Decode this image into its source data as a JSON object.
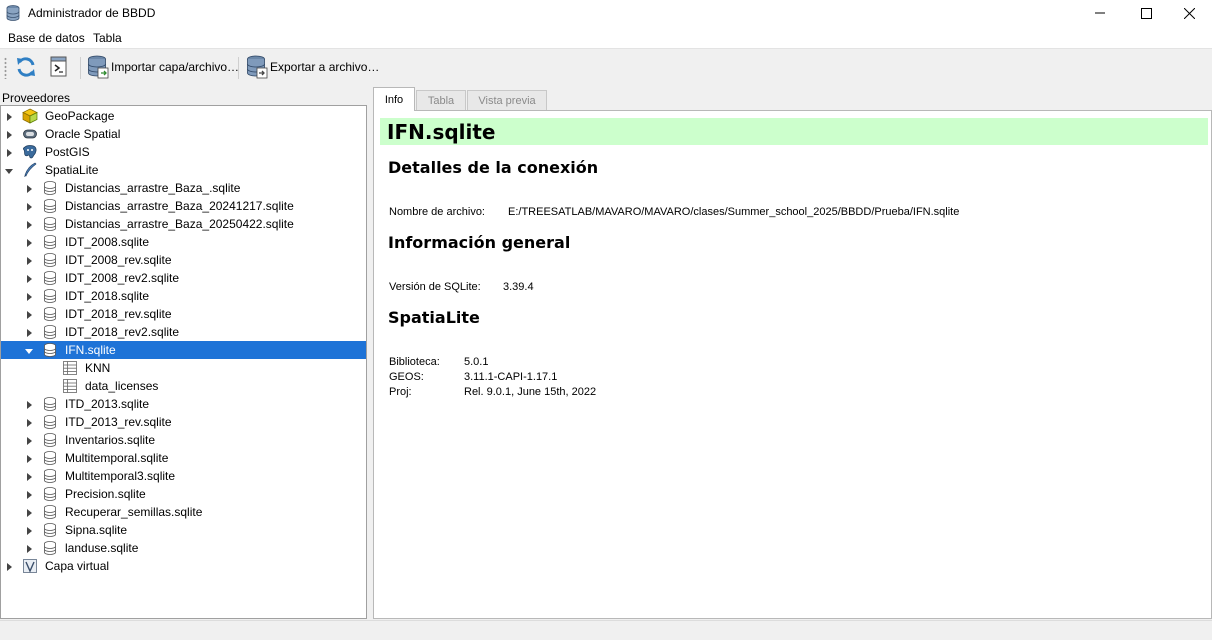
{
  "window": {
    "title": "Administrador de BBDD"
  },
  "menu": {
    "items": [
      "Base de datos",
      "Tabla"
    ]
  },
  "toolbar": {
    "import_label": "Importar capa/archivo…",
    "export_label": "Exportar a archivo…"
  },
  "providers": {
    "header": "Proveedores",
    "items": [
      {
        "label": "GeoPackage",
        "level": 0,
        "expanded": false,
        "icon": "geopackage-icon"
      },
      {
        "label": "Oracle Spatial",
        "level": 0,
        "expanded": false,
        "icon": "oracle-icon"
      },
      {
        "label": "PostGIS",
        "level": 0,
        "expanded": false,
        "icon": "postgis-icon"
      },
      {
        "label": "SpatiaLite",
        "level": 0,
        "expanded": true,
        "icon": "spatialite-icon"
      },
      {
        "label": "Distancias_arrastre_Baza_.sqlite",
        "level": 1,
        "icon": "database-icon"
      },
      {
        "label": "Distancias_arrastre_Baza_20241217.sqlite",
        "level": 1,
        "icon": "database-icon"
      },
      {
        "label": "Distancias_arrastre_Baza_20250422.sqlite",
        "level": 1,
        "icon": "database-icon"
      },
      {
        "label": "IDT_2008.sqlite",
        "level": 1,
        "icon": "database-icon"
      },
      {
        "label": "IDT_2008_rev.sqlite",
        "level": 1,
        "icon": "database-icon"
      },
      {
        "label": "IDT_2008_rev2.sqlite",
        "level": 1,
        "icon": "database-icon"
      },
      {
        "label": "IDT_2018.sqlite",
        "level": 1,
        "icon": "database-icon"
      },
      {
        "label": "IDT_2018_rev.sqlite",
        "level": 1,
        "icon": "database-icon"
      },
      {
        "label": "IDT_2018_rev2.sqlite",
        "level": 1,
        "icon": "database-icon"
      },
      {
        "label": "IFN.sqlite",
        "level": 1,
        "expanded": true,
        "selected": true,
        "icon": "database-icon"
      },
      {
        "label": "KNN",
        "level": 2,
        "icon": "table-icon"
      },
      {
        "label": "data_licenses",
        "level": 2,
        "icon": "table-icon"
      },
      {
        "label": "ITD_2013.sqlite",
        "level": 1,
        "icon": "database-icon"
      },
      {
        "label": "ITD_2013_rev.sqlite",
        "level": 1,
        "icon": "database-icon"
      },
      {
        "label": "Inventarios.sqlite",
        "level": 1,
        "icon": "database-icon"
      },
      {
        "label": "Multitemporal.sqlite",
        "level": 1,
        "icon": "database-icon"
      },
      {
        "label": "Multitemporal3.sqlite",
        "level": 1,
        "icon": "database-icon"
      },
      {
        "label": "Precision.sqlite",
        "level": 1,
        "icon": "database-icon"
      },
      {
        "label": "Recuperar_semillas.sqlite",
        "level": 1,
        "icon": "database-icon"
      },
      {
        "label": "Sipna.sqlite",
        "level": 1,
        "icon": "database-icon"
      },
      {
        "label": "landuse.sqlite",
        "level": 1,
        "icon": "database-icon"
      },
      {
        "label": "Capa virtual",
        "level": 0,
        "expanded": false,
        "icon": "virtual-layer-icon"
      }
    ]
  },
  "tabs": [
    "Info",
    "Tabla",
    "Vista previa"
  ],
  "info": {
    "title": "IFN.sqlite",
    "connection_heading": "Detalles de la conexión",
    "filename_label": "Nombre de archivo:",
    "filename_value": "E:/TREESATLAB/MAVARO/MAVARO/clases/Summer_school_2025/BBDD/Prueba/IFN.sqlite",
    "general_heading": "Información general",
    "sqlite_version_label": "Versión de SQLite:",
    "sqlite_version_value": "3.39.4",
    "spatialite_heading": "SpatiaLite",
    "library_label": "Biblioteca:",
    "library_value": "5.0.1",
    "geos_label": "GEOS:",
    "geos_value": "3.11.1-CAPI-1.17.1",
    "proj_label": "Proj:",
    "proj_value": "Rel. 9.0.1, June 15th, 2022"
  },
  "colors": {
    "selection": "#1e73d7",
    "banner": "#ccffcc"
  }
}
